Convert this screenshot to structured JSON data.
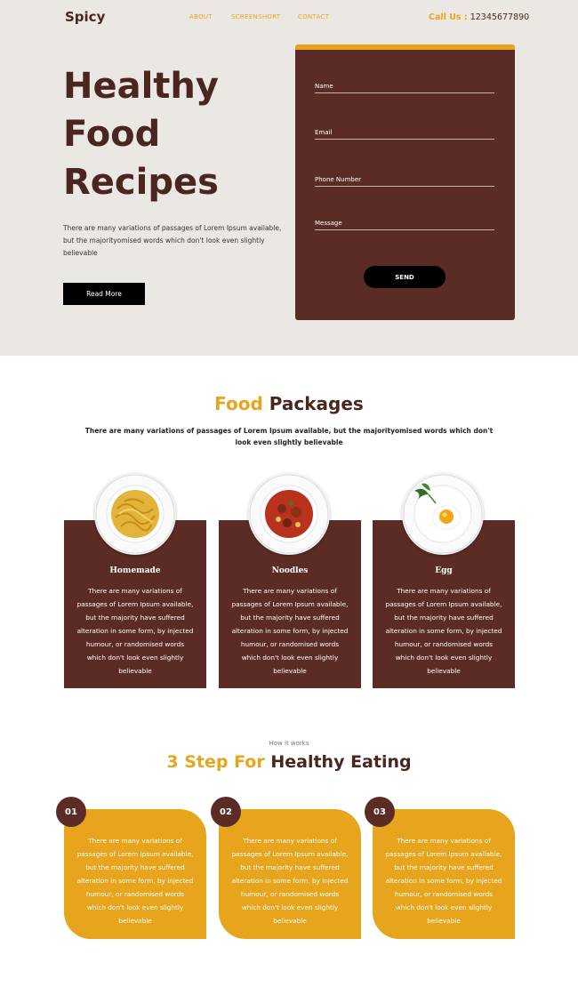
{
  "header": {
    "logo": "Spicy",
    "nav": [
      "ABOUT",
      "SCREENSHORT",
      "CONTACT"
    ],
    "call_label": "Call Us :",
    "call_number": "12345677890"
  },
  "hero": {
    "title_lines": [
      "Healthy",
      "Food",
      "Recipes"
    ],
    "text": "There are many variations of passages of Lorem Ipsum available, but the majorityomised words which don't look even slightly believable",
    "button": "Read More"
  },
  "form": {
    "name_placeholder": "Name",
    "email_placeholder": "Email",
    "phone_placeholder": "Phone Number",
    "message_placeholder": "Message",
    "send": "SEND"
  },
  "packages": {
    "title_accent": "Food",
    "title_rest": "Packages",
    "subtitle": "There are many variations of passages of Lorem Ipsum available, but the majorityomised words which don't look even slightly believable",
    "items": [
      {
        "name": "Homemade",
        "text": "There are many variations of passages of Lorem Ipsum available, but the majority have suffered alteration in some form, by injected humour, or randomised words which don't look even slightly believable"
      },
      {
        "name": "Noodles",
        "text": "There are many variations of passages of Lorem Ipsum available, but the majority have suffered alteration in some form, by injected humour, or randomised words which don't look even slightly believable"
      },
      {
        "name": "Egg",
        "text": "There are many variations of passages of Lorem Ipsum available, but the majority have suffered alteration in some form, by injected humour, or randomised words which don't look even slightly believable"
      }
    ]
  },
  "steps": {
    "eyebrow": "How it works",
    "title_accent": "3 Step For",
    "title_rest": "Healthy Eating",
    "items": [
      {
        "num": "01",
        "text": "There are many variations of passages of Lorem Ipsum available, but the majority have suffered alteration in some form, by injected humour, or randomised words which don't look even slightly believable"
      },
      {
        "num": "02",
        "text": "There are many variations of passages of Lorem Ipsum available, but the majority have suffered alteration in some form, by injected humour, or randomised words which don't look even slightly believable"
      },
      {
        "num": "03",
        "text": "There are many variations of passages of Lorem Ipsum available, but the majority have suffered alteration in some form, by injected humour, or randomised words which don't look even slightly believable"
      }
    ]
  },
  "colors": {
    "accent": "#e7a51d",
    "brown": "#5a2c25",
    "hero_bg": "#ebe8e3"
  }
}
